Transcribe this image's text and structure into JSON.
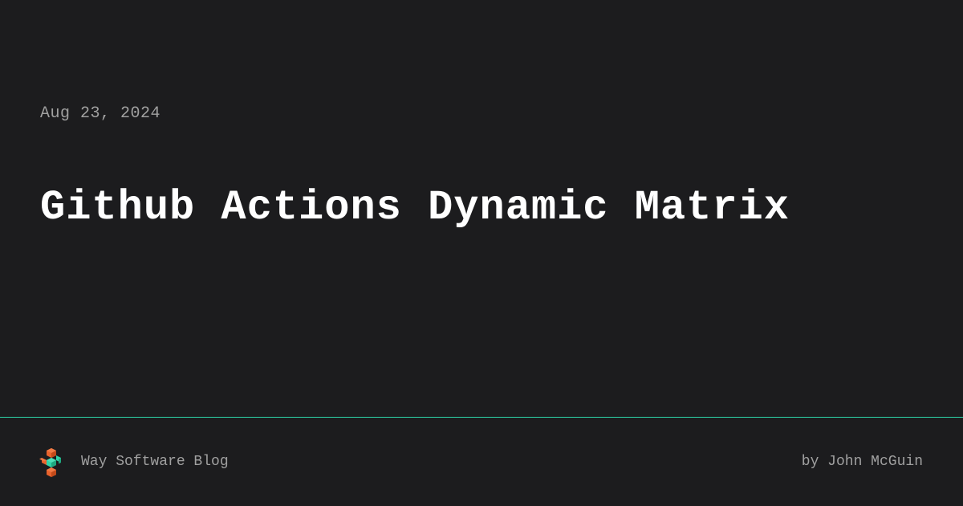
{
  "post": {
    "date": "Aug 23, 2024",
    "title": "Github Actions Dynamic Matrix"
  },
  "footer": {
    "blog_name": "Way Software Blog",
    "author_prefix": "by ",
    "author_name": "John McGuin"
  },
  "colors": {
    "background": "#1c1c1e",
    "text_primary": "#ffffff",
    "text_secondary": "#a0a0a0",
    "accent": "#2dd4a8",
    "logo_orange": "#e8622c",
    "logo_green": "#2dd4a8"
  }
}
